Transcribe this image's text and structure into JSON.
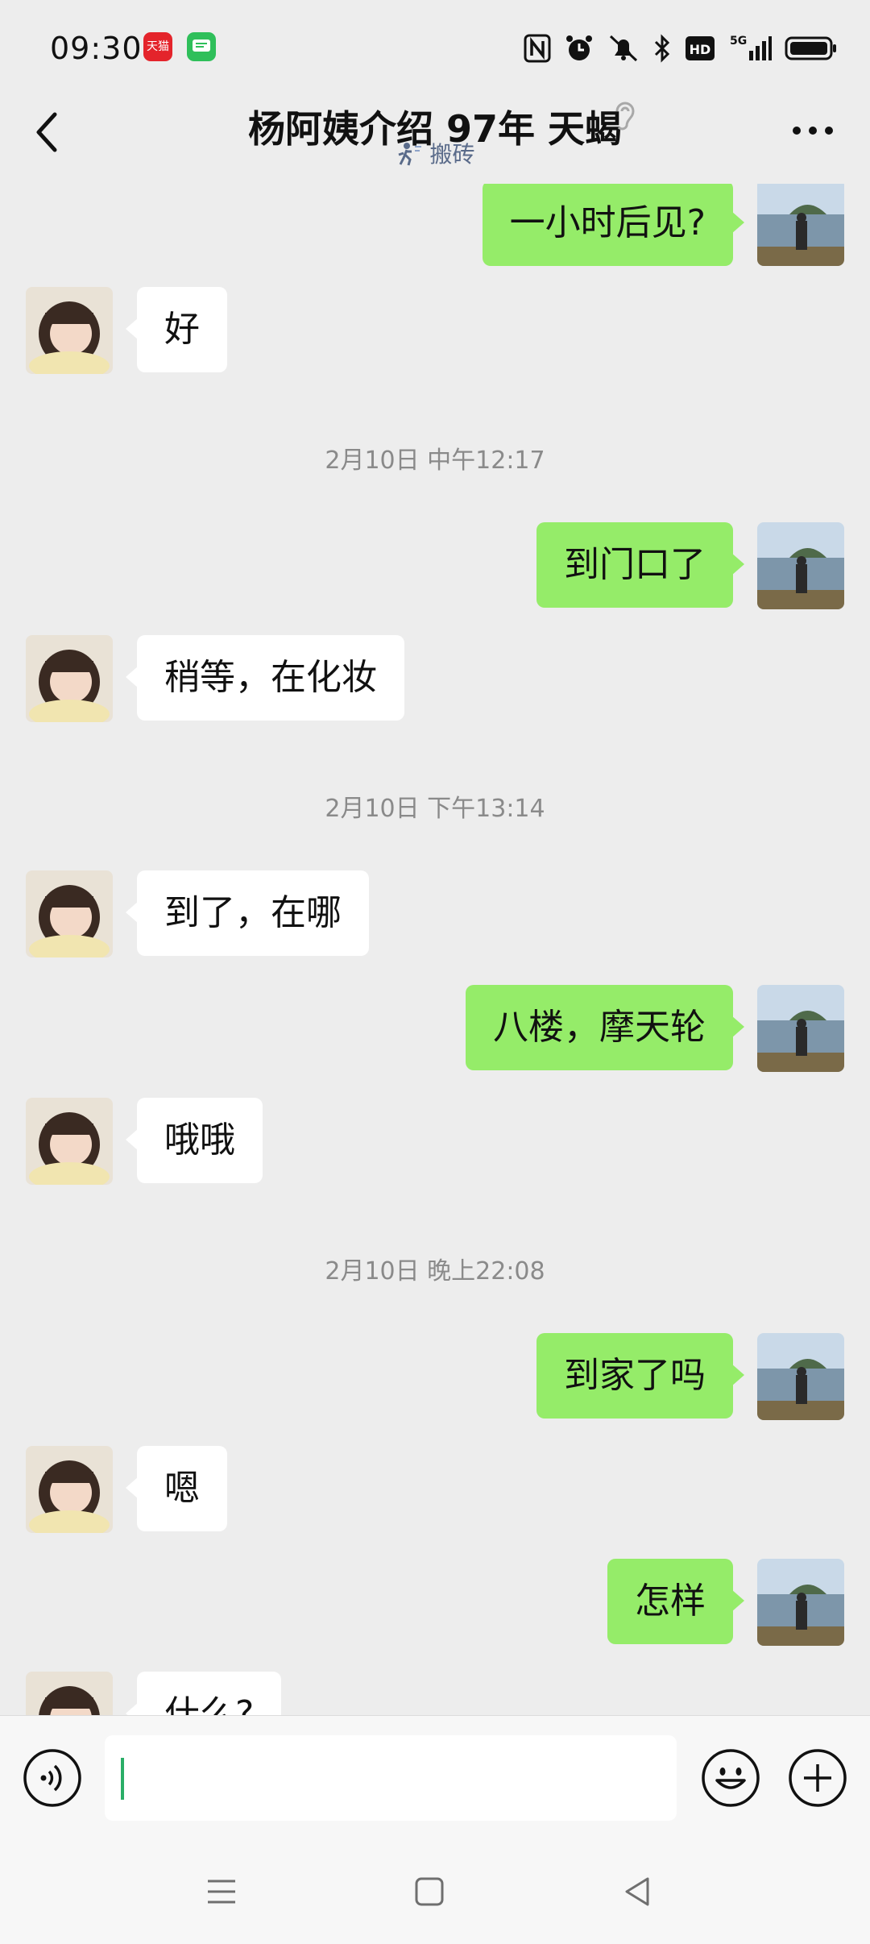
{
  "status_bar": {
    "time": "09:30",
    "tmall_label": "天猫",
    "network_label": "5G",
    "hd_label": "HD",
    "icons": [
      "tmall-icon",
      "message-app-icon",
      "nfc-icon",
      "alarm-icon",
      "mute-icon",
      "bluetooth-icon",
      "hd-icon",
      "signal-icon",
      "battery-icon"
    ]
  },
  "header": {
    "title": "杨阿姨介绍 97年 天蝎",
    "subtitle": "搬砖",
    "icons": [
      "back-icon",
      "ear-icon",
      "more-icon"
    ]
  },
  "messages": [
    {
      "type": "out",
      "text": "一小时后见?"
    },
    {
      "type": "in",
      "text": "好"
    },
    {
      "type": "timestamp",
      "text": "2月10日 中午12:17"
    },
    {
      "type": "out",
      "text": "到门口了"
    },
    {
      "type": "in",
      "text": "稍等，在化妆"
    },
    {
      "type": "timestamp",
      "text": "2月10日 下午13:14"
    },
    {
      "type": "in",
      "text": "到了，在哪"
    },
    {
      "type": "out",
      "text": "八楼，摩天轮"
    },
    {
      "type": "in",
      "text": "哦哦"
    },
    {
      "type": "timestamp",
      "text": "2月10日 晚上22:08"
    },
    {
      "type": "out",
      "text": "到家了吗"
    },
    {
      "type": "in",
      "text": "嗯"
    },
    {
      "type": "out",
      "text": "怎样"
    },
    {
      "type": "in",
      "text": "什么?"
    }
  ],
  "input_bar": {
    "value": "",
    "icons": [
      "voice-icon",
      "emoji-icon",
      "plus-icon"
    ]
  },
  "nav_bar": {
    "icons": [
      "menu-icon",
      "home-icon",
      "back-triangle-icon"
    ]
  },
  "colors": {
    "background": "#ededed",
    "outgoing_bubble": "#95ec69",
    "incoming_bubble": "#ffffff",
    "caret": "#2aae67"
  }
}
